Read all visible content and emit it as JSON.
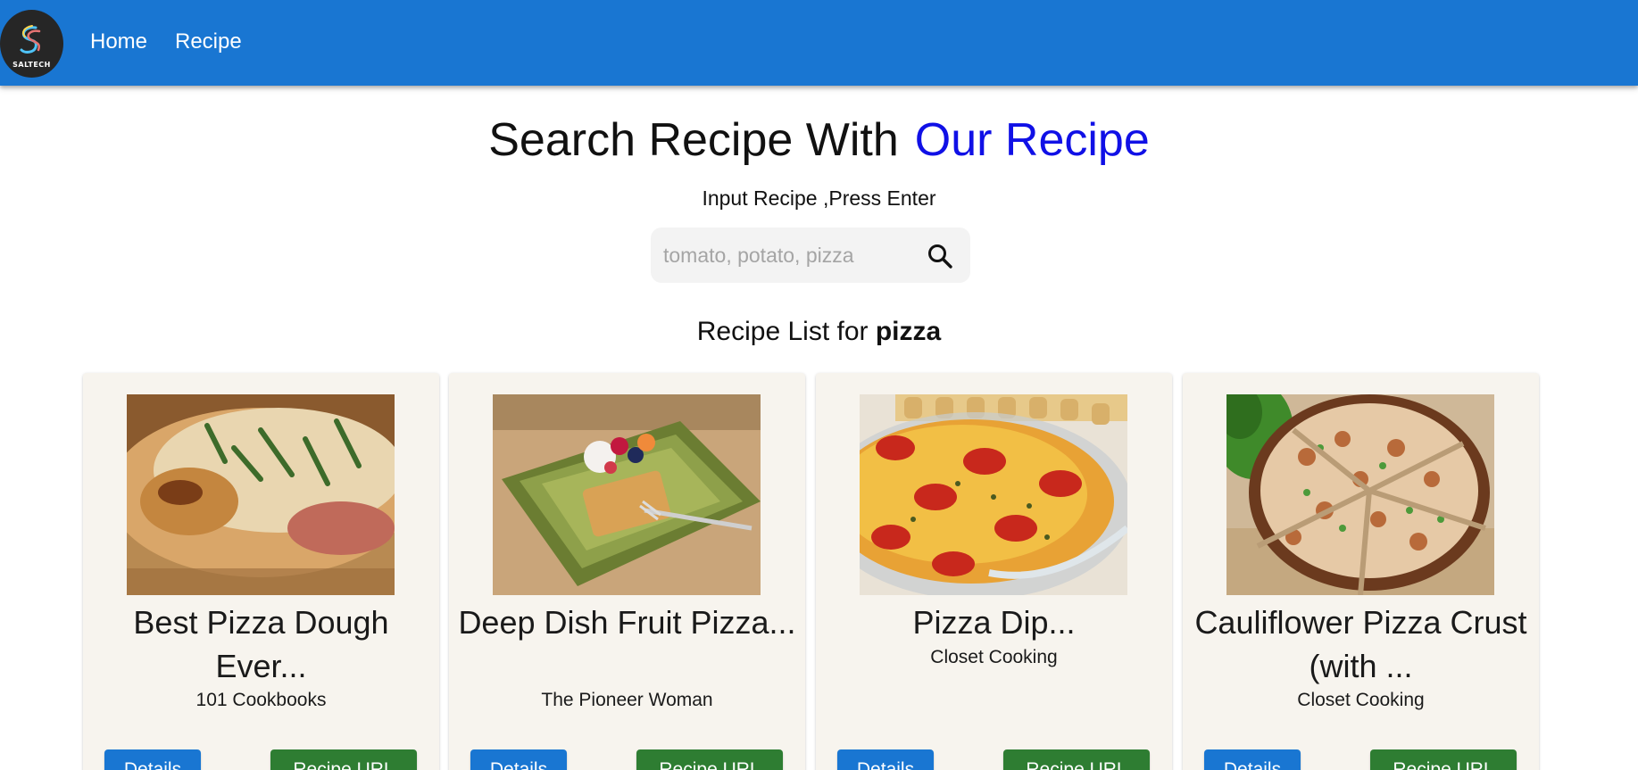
{
  "navbar": {
    "logo_text": "SALTECH",
    "links": [
      "Home",
      "Recipe"
    ]
  },
  "hero": {
    "title": "Search Recipe With",
    "title_accent": "Our Recipe",
    "subtitle": "Input Recipe ,Press Enter"
  },
  "search": {
    "placeholder": "tomato, potato, pizza",
    "value": "",
    "icon": "search-icon"
  },
  "results": {
    "heading_prefix": "Recipe List for",
    "query": "pizza"
  },
  "cards": [
    {
      "title": "Best Pizza Dough Ever...",
      "source": "101 Cookbooks",
      "details_label": "Details",
      "url_label": "Recipe URL"
    },
    {
      "title": "Deep Dish Fruit Pizza...",
      "source": "The Pioneer Woman",
      "details_label": "Details",
      "url_label": "Recipe URL"
    },
    {
      "title": "Pizza Dip...",
      "source": "Closet Cooking",
      "details_label": "Details",
      "url_label": "Recipe URL"
    },
    {
      "title": "Cauliflower Pizza Crust (with ...",
      "source": "Closet Cooking",
      "details_label": "Details",
      "url_label": "Recipe URL"
    }
  ],
  "colors": {
    "navbar": "#1976d2",
    "accent_text": "#1010e6",
    "details_button": "#1976d2",
    "url_button": "#2e7d32",
    "card_background": "#f7f4ee"
  }
}
